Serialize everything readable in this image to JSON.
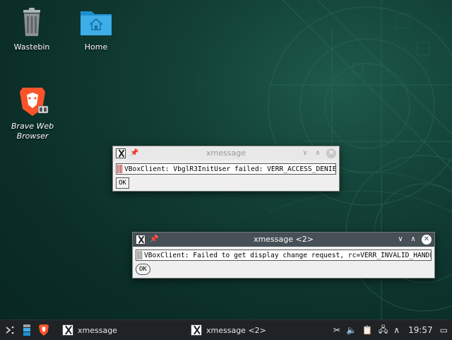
{
  "desktop": {
    "icons": [
      {
        "label": "Wastebin",
        "icon": "trash-icon"
      },
      {
        "label": "Home",
        "icon": "home-folder-icon"
      },
      {
        "label": "Brave Web Browser",
        "icon": "brave-browser-icon"
      }
    ]
  },
  "windows": [
    {
      "title": "xmessage",
      "state": "inactive",
      "message": "VBoxClient: VbglR3InitUser failed: VERR_ACCESS_DENIED",
      "ok_label": "OK"
    },
    {
      "title": "xmessage <2>",
      "state": "active",
      "message": "VBoxClient: Failed to get display change request, rc=VERR_INVALID_HANDLE",
      "ok_label": "OK"
    }
  ],
  "taskbar": {
    "tasks": [
      {
        "label": "xmessage"
      },
      {
        "label": "xmessage <2>"
      }
    ],
    "clock": "19:57"
  },
  "colors": {
    "desktop_bg": "#0b2e28",
    "active_titlebar": "#475057",
    "taskbar_bg": "#1f2326",
    "brave_orange": "#fb542b",
    "folder_blue": "#3daee9"
  }
}
